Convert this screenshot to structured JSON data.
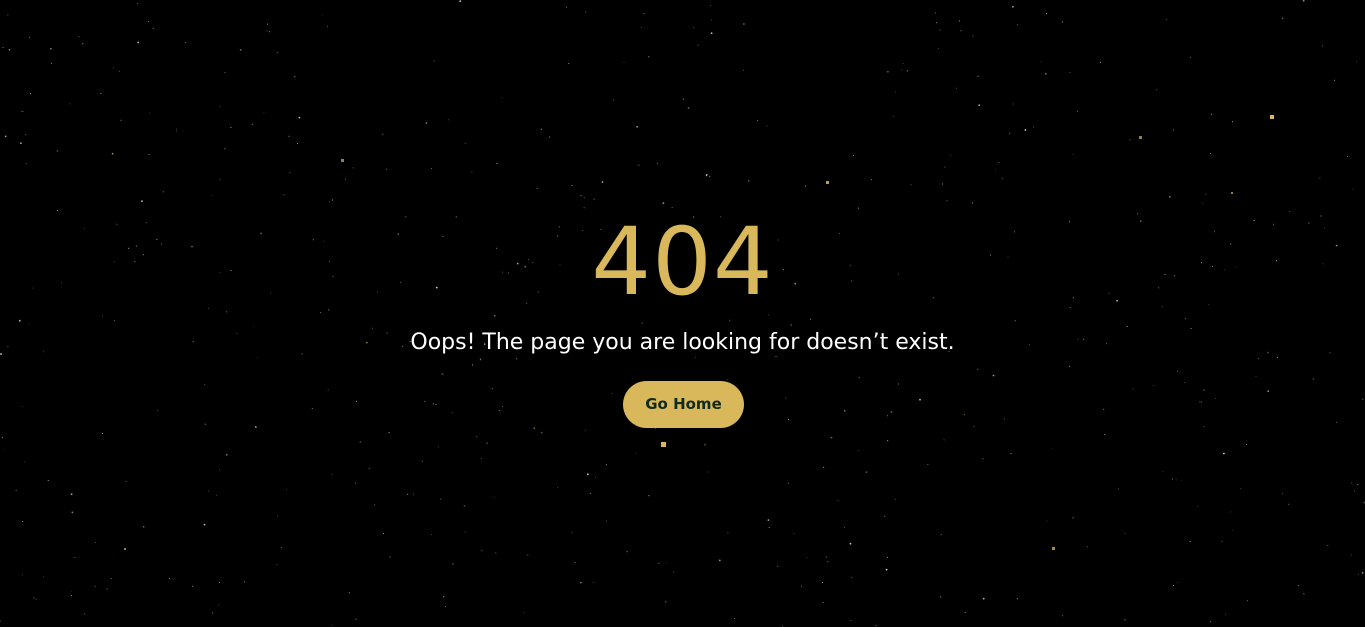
{
  "error": {
    "code": "404",
    "message": "Oops! The page you are looking for doesn’t exist."
  },
  "actions": {
    "home_label": "Go Home"
  },
  "colors": {
    "background": "#000000",
    "accent": "#d8b85a",
    "message_text": "#ffffff",
    "button_text": "#102a1c"
  }
}
